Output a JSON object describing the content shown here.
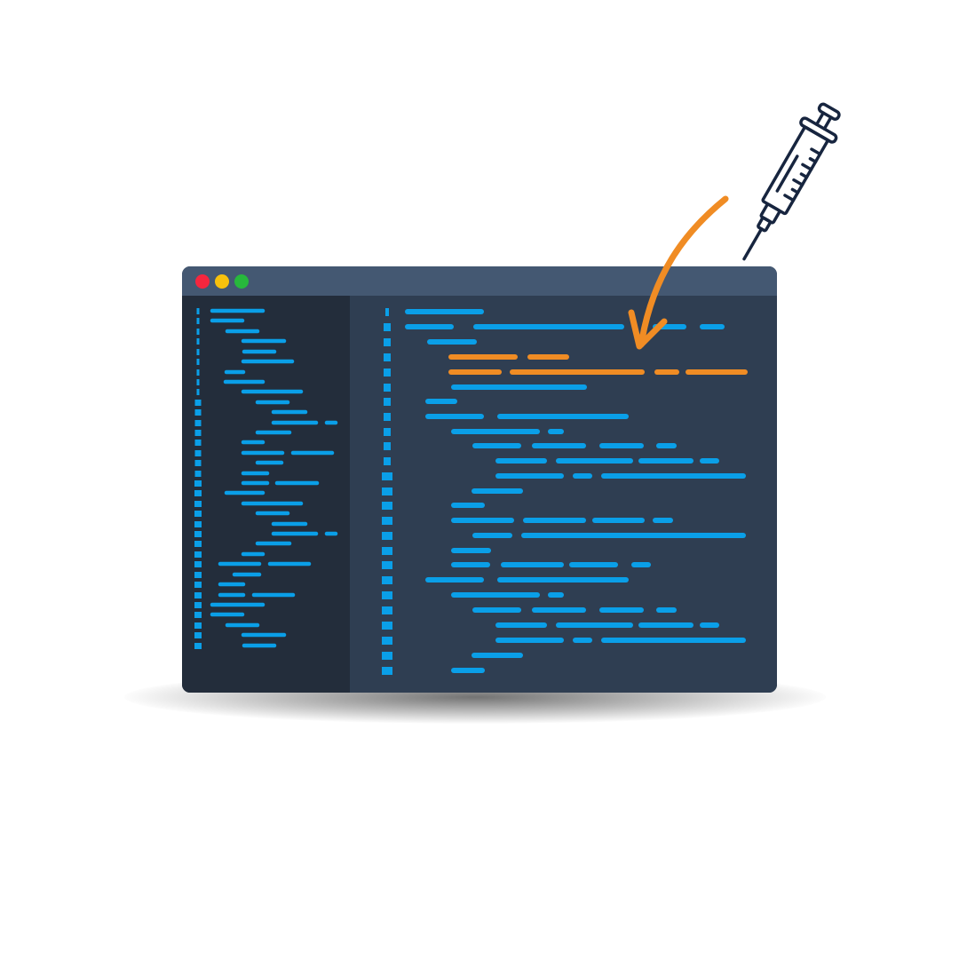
{
  "colors": {
    "window_frame": "#2f3e52",
    "titlebar": "#445872",
    "sidebar_bg": "#232d3b",
    "editor_bg": "#2f3e52",
    "code_blue": "#0a9fe8",
    "highlight_orange": "#f08c24",
    "dot_close": "#f5263e",
    "dot_minimize": "#f7c10c",
    "dot_maximize": "#27b83c",
    "syringe_stroke": "#17253f"
  },
  "window_controls": [
    "close",
    "minimize",
    "maximize"
  ],
  "icons": {
    "syringe": "syringe-icon",
    "arrow": "curved-arrow-icon"
  }
}
